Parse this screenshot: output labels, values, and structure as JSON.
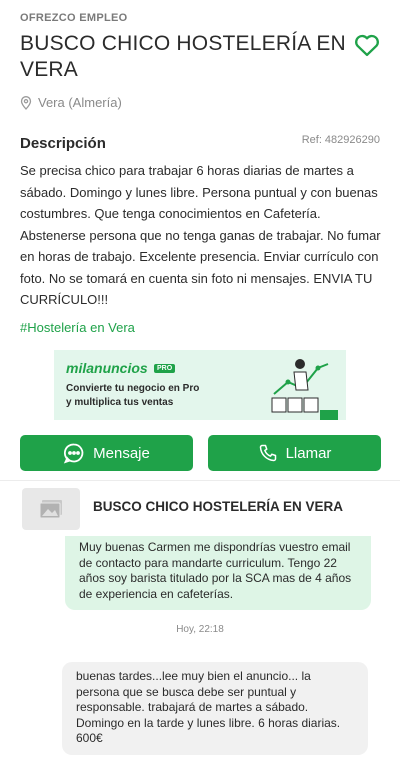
{
  "listing": {
    "category": "OFREZCO EMPLEO",
    "title": "BUSCO CHICO HOSTELERÍA EN VERA",
    "location": "Vera (Almería)",
    "description_heading": "Descripción",
    "ref": "Ref: 482926290",
    "description": "Se precisa chico para trabajar 6 horas diarias de martes a sábado.  Domingo y lunes libre. Persona puntual y con buenas costumbres.  Que tenga conocimientos en Cafetería. Abstenerse persona que no tenga ganas de trabajar. No fumar en horas de trabajo. Excelente presencia. Enviar currículo con foto. No se tomará en cuenta sin foto ni mensajes. ENVIA TU CURRÍCULO!!!",
    "tag": "#Hostelería en Vera"
  },
  "banner": {
    "brand": "milanuncios",
    "badge": "PRO",
    "line1": "Convierte tu negocio en Pro",
    "line2": "y multiplica tus ventas"
  },
  "actions": {
    "message_label": "Mensaje",
    "call_label": "Llamar"
  },
  "chat": {
    "title": "BUSCO CHICO HOSTELERÍA EN VERA",
    "outgoing": "Muy buenas Carmen me dispondrías vuestro email de contacto para mandarte curriculum. Tengo 22 años soy barista titulado por la SCA mas de 4 años de experiencia en cafeterías.",
    "timestamp": "Hoy, 22:18",
    "incoming": "buenas tardes...lee muy bien el anuncio... la persona que se busca debe ser puntual y responsable. trabajará de martes a sábado. Domingo en la tarde y lunes libre. 6 horas diarias. 600€"
  },
  "colors": {
    "accent": "#1fa249",
    "outgoing_bubble": "#def5e6",
    "incoming_bubble": "#f1f1f1"
  }
}
